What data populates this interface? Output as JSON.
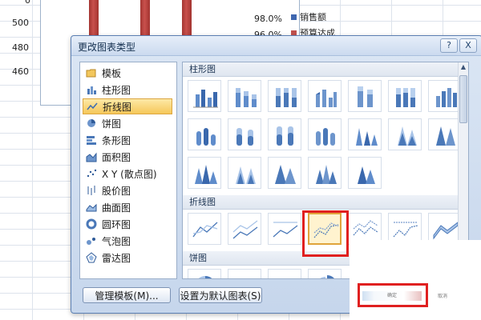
{
  "spreadsheet": {
    "axis_labels": [
      "500",
      "480",
      "460"
    ],
    "percent_labels": [
      "98.0%",
      "96.0%"
    ],
    "legend": [
      {
        "label": "销售额",
        "color": "#3f67b0"
      },
      {
        "label": "预算达成",
        "color": "#c0504d"
      }
    ]
  },
  "dialog": {
    "title": "更改图表类型",
    "help": "?",
    "close": "X",
    "categories": [
      {
        "label": "模板",
        "icon": "folder-icon"
      },
      {
        "label": "柱形图",
        "icon": "column-chart-icon"
      },
      {
        "label": "折线图",
        "icon": "line-chart-icon",
        "selected": true
      },
      {
        "label": "饼图",
        "icon": "pie-chart-icon"
      },
      {
        "label": "条形图",
        "icon": "bar-chart-icon"
      },
      {
        "label": "面积图",
        "icon": "area-chart-icon"
      },
      {
        "label": "X Y (散点图)",
        "icon": "scatter-chart-icon"
      },
      {
        "label": "股价图",
        "icon": "stock-chart-icon"
      },
      {
        "label": "曲面图",
        "icon": "surface-chart-icon"
      },
      {
        "label": "圆环图",
        "icon": "doughnut-chart-icon"
      },
      {
        "label": "气泡图",
        "icon": "bubble-chart-icon"
      },
      {
        "label": "雷达图",
        "icon": "radar-chart-icon"
      }
    ],
    "sections": {
      "column": "柱形图",
      "line": "折线图",
      "pie": "饼图"
    },
    "buttons": {
      "manage_templates": "管理模板(M)...",
      "set_default": "设置为默认图表(S)",
      "ok": "确定",
      "cancel": "取消"
    },
    "accent": "#e02020"
  }
}
